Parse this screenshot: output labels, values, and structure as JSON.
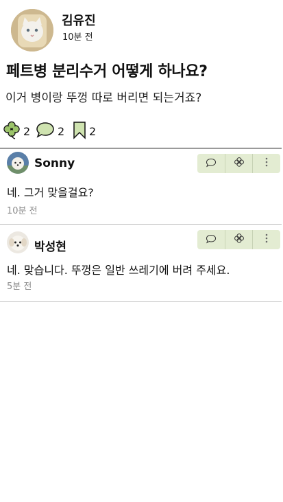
{
  "post": {
    "author": "김유진",
    "time": "10분 전",
    "title": "페트병 분리수거 어떻게 하나요?",
    "body": "이거 병이랑 뚜껑 따로 버리면 되는거죠?",
    "stats": {
      "likes": "2",
      "comments": "2",
      "bookmarks": "2"
    }
  },
  "comments": [
    {
      "author": "Sonny",
      "body": "네. 그거 맞을걸요?",
      "time": "10분 전"
    },
    {
      "author": "박성현",
      "body": "네. 맞습니다. 뚜껑은 일반 쓰레기에 버려 주세요.",
      "time": "5분 전"
    }
  ],
  "icons": {
    "like": "clover-icon",
    "comment": "speech-bubble-icon",
    "bookmark": "bookmark-icon",
    "more": "more-vertical-icon"
  },
  "colors": {
    "action_bar": "#e3ecd2",
    "bookmark_fill": "#cfe3b0"
  }
}
